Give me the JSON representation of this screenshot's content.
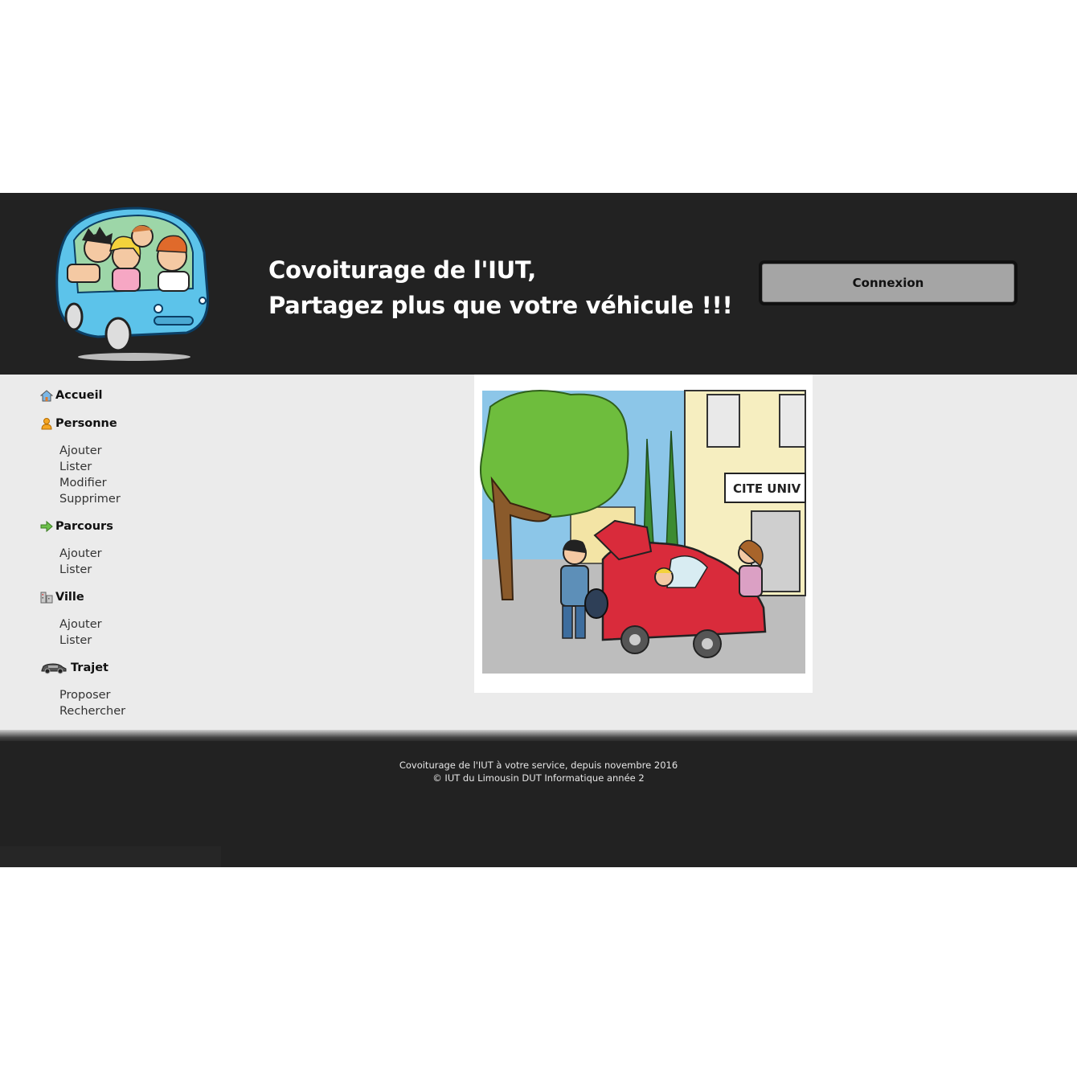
{
  "header": {
    "slogan_line1": "Covoiturage de l'IUT,",
    "slogan_line2": "Partagez plus que votre véhicule !!!",
    "connexion_label": "Connexion",
    "logo_icon": "carpool-logo-icon"
  },
  "menu": {
    "accueil": "Accueil",
    "personne": "Personne",
    "personne_items": [
      "Ajouter",
      "Lister",
      "Modifier",
      "Supprimer"
    ],
    "parcours": "Parcours",
    "parcours_items": [
      "Ajouter",
      "Lister"
    ],
    "ville": "Ville",
    "ville_items": [
      "Ajouter",
      "Lister"
    ],
    "trajet": "Trajet",
    "trajet_items": [
      "Proposer",
      "Rechercher"
    ]
  },
  "illustration": {
    "sign_text": "CITE UNIV"
  },
  "footer": {
    "line1": "Covoiturage de l'IUT à votre service, depuis novembre 2016",
    "line2": "© IUT du Limousin DUT Informatique année 2"
  },
  "colors": {
    "header_bg": "#222222",
    "content_bg": "#ebebeb",
    "button_bg": "#a5a5a5"
  }
}
